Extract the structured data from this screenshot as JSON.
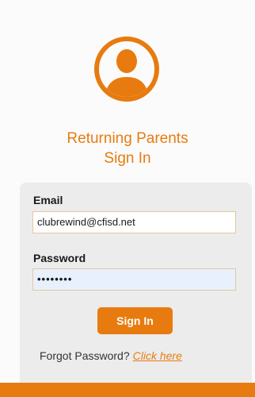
{
  "header": {
    "icon": "user-icon",
    "title_line1": "Returning Parents",
    "title_line2": "Sign In"
  },
  "form": {
    "email_label": "Email",
    "email_value": "clubrewind@cfisd.net",
    "password_label": "Password",
    "password_value": "••••••••",
    "signin_label": "Sign In",
    "forgot_text": "Forgot Password?",
    "forgot_link": "Click here"
  },
  "colors": {
    "accent": "#e87b0f",
    "panel": "#ececec",
    "password_fill": "#e8f0fe"
  }
}
